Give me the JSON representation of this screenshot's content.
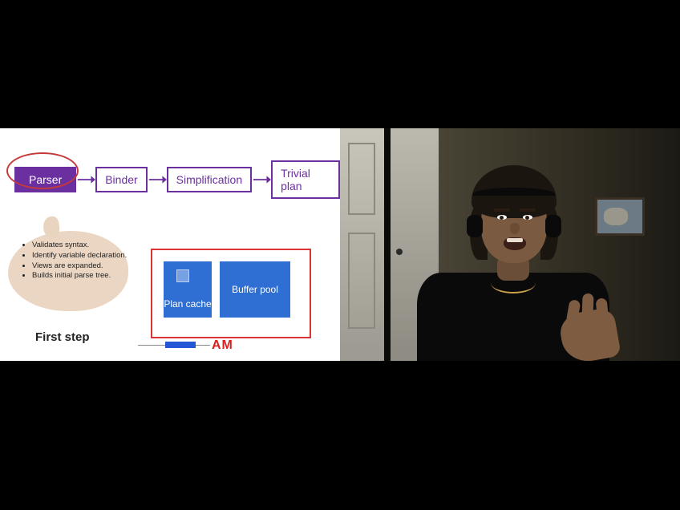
{
  "flow": {
    "steps": [
      "Parser",
      "Binder",
      "Simplification",
      "Trivial plan"
    ],
    "highlighted_index": 0
  },
  "callout": {
    "items": [
      "Validates syntax.",
      "Identify variable declaration.",
      "Views are expanded.",
      "Builds initial parse tree."
    ]
  },
  "first_step_label": "First step",
  "ram": {
    "plan_cache_label": "Plan cache",
    "buffer_pool_label": "Buffer pool",
    "caption_partial": "AM"
  },
  "colors": {
    "purple": "#6b2fa0",
    "highlight_red": "#c43a3a",
    "ram_blue": "#2f6fd3",
    "ram_border_red": "#d33"
  }
}
